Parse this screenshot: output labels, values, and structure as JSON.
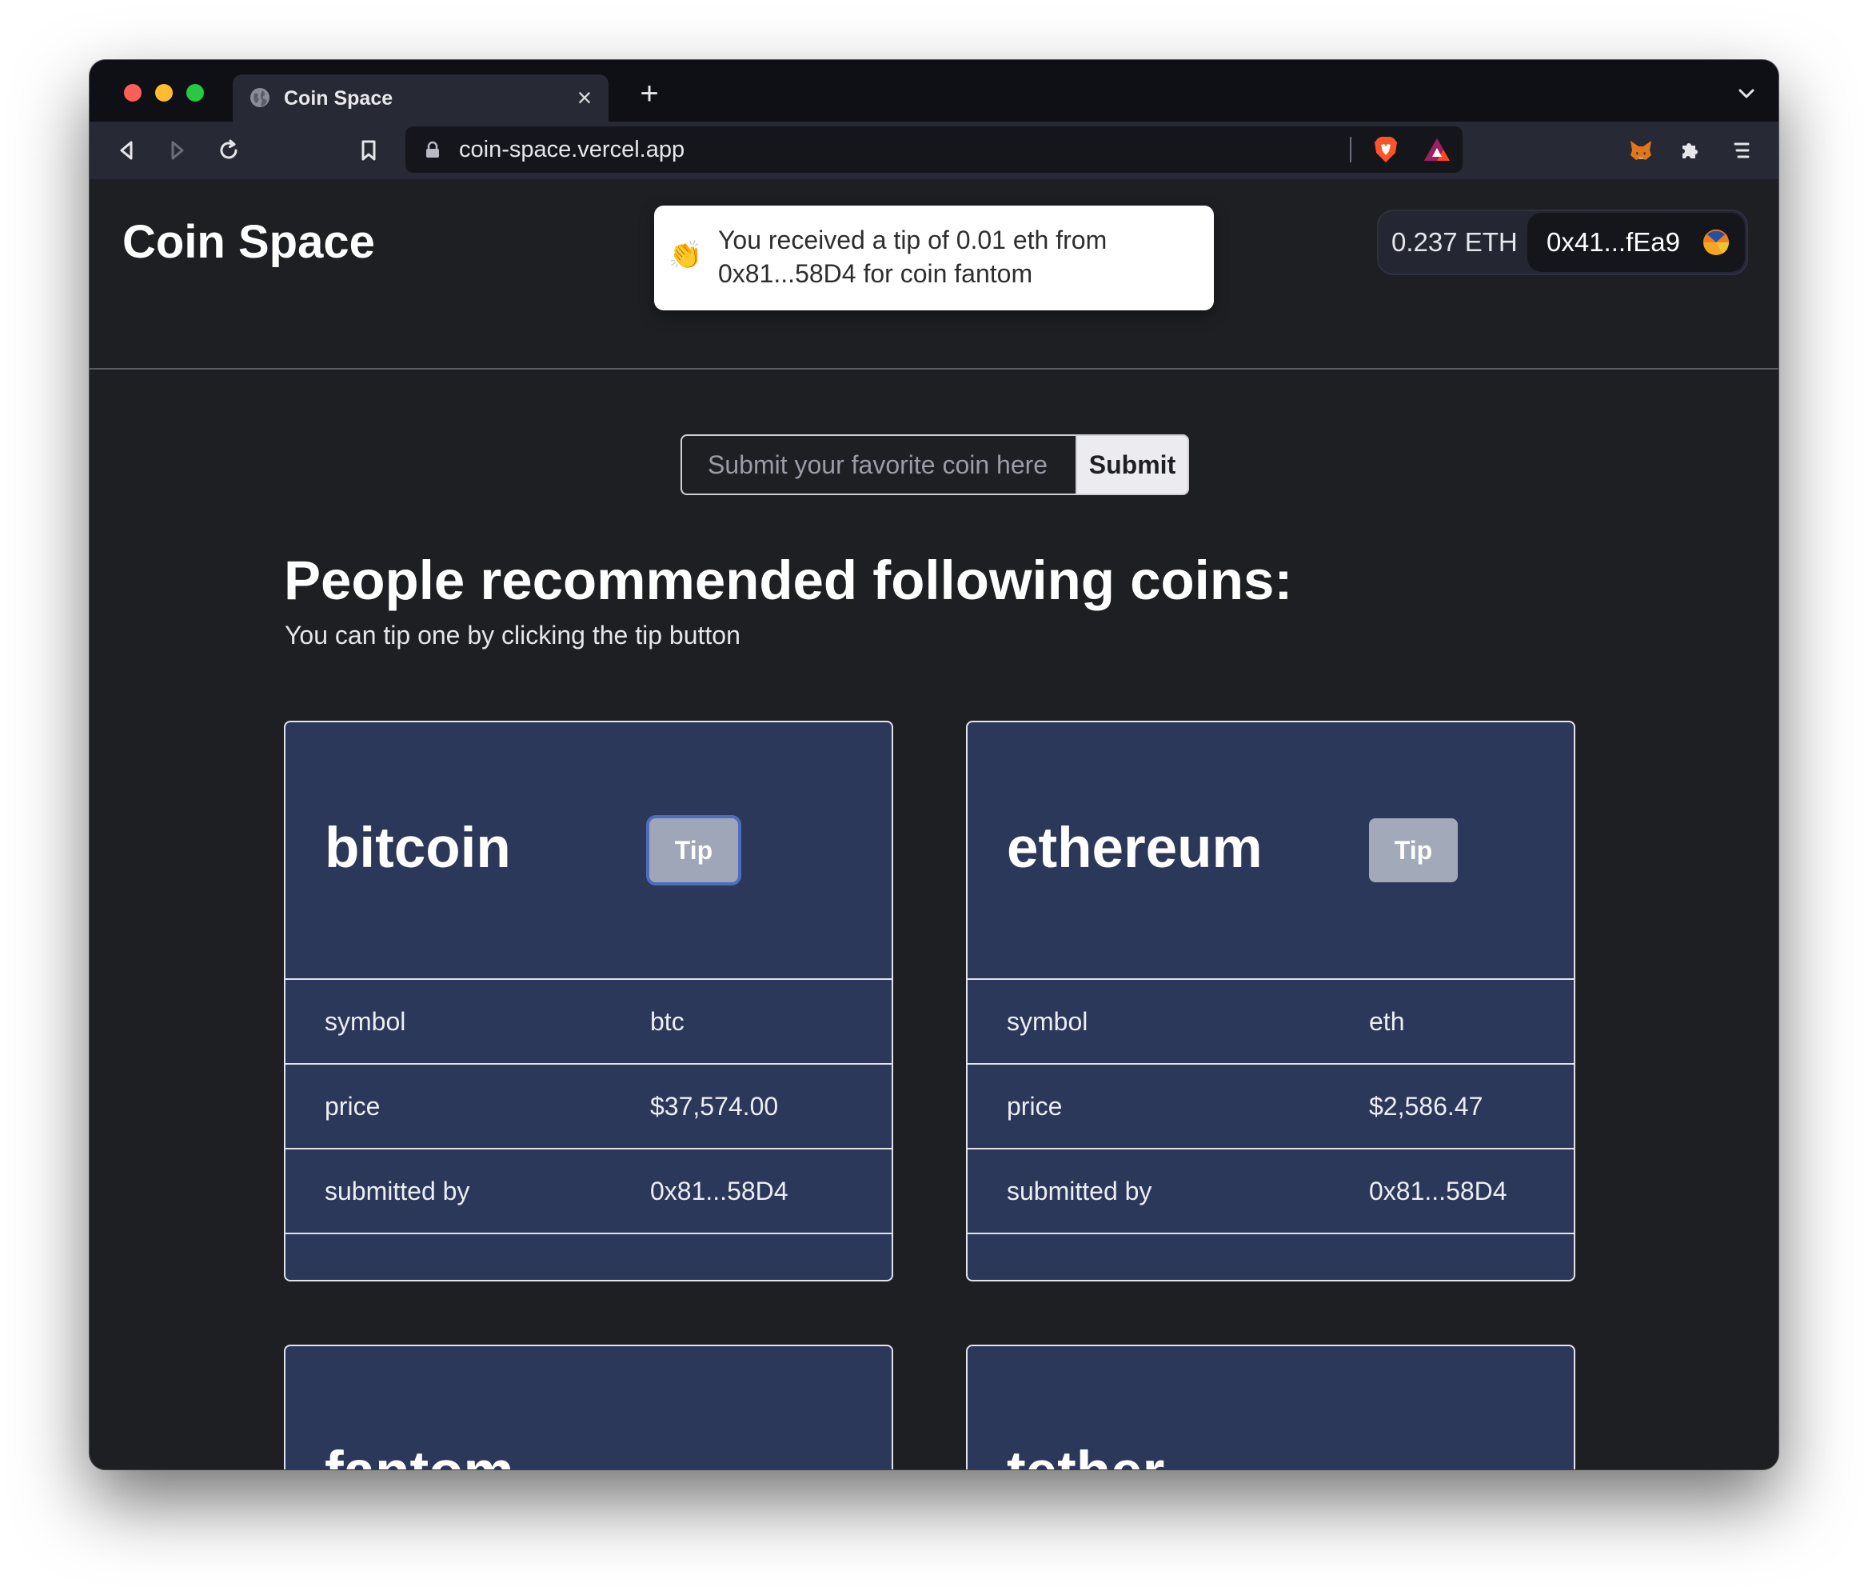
{
  "browser": {
    "tab_title": "Coin Space",
    "url": "coin-space.vercel.app"
  },
  "header": {
    "brand": "Coin Space",
    "wallet": {
      "balance": "0.237 ETH",
      "address": "0x41...fEa9"
    }
  },
  "toast": {
    "icon": "clapping-hands-icon",
    "message": "You received a tip of 0.01 eth from 0x81...58D4 for coin fantom"
  },
  "submit_form": {
    "placeholder": "Submit your favorite coin here",
    "value": "",
    "button_label": "Submit"
  },
  "section": {
    "title": "People recommended following coins:",
    "subtitle": "You can tip one by clicking the tip button"
  },
  "coins": [
    {
      "name": "bitcoin",
      "tip_label": "Tip",
      "rows": [
        {
          "key": "symbol",
          "value": "btc"
        },
        {
          "key": "price",
          "value": "$37,574.00"
        },
        {
          "key": "submitted by",
          "value": "0x81...58D4"
        }
      ]
    },
    {
      "name": "ethereum",
      "tip_label": "Tip",
      "rows": [
        {
          "key": "symbol",
          "value": "eth"
        },
        {
          "key": "price",
          "value": "$2,586.47"
        },
        {
          "key": "submitted by",
          "value": "0x81...58D4"
        }
      ]
    },
    {
      "name": "fantom"
    },
    {
      "name": "tether"
    }
  ],
  "colors": {
    "page_bg": "#1e1f23",
    "card_bg": "#2c385a",
    "tip_button": "#a2a9b8",
    "focus_ring": "#4d6dbd"
  }
}
